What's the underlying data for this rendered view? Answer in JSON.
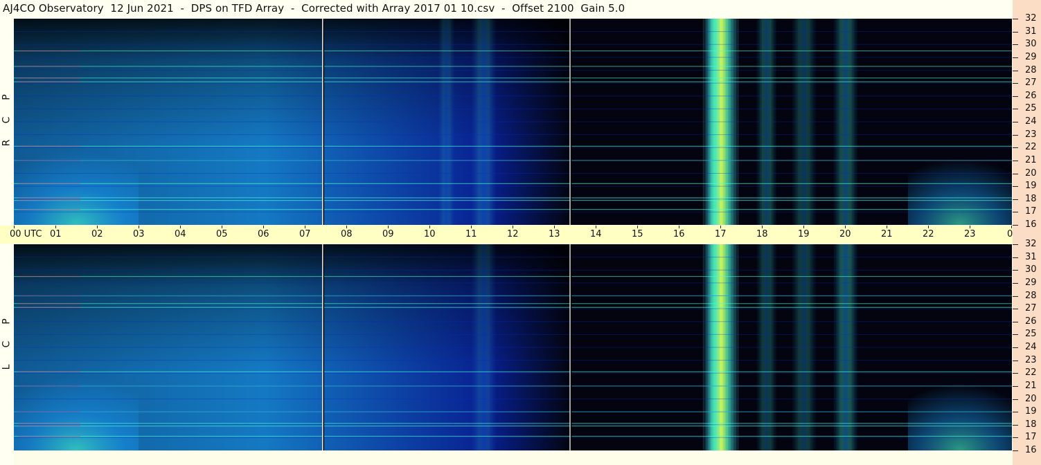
{
  "header": {
    "title": "AJ4CO Observatory  12 Jun 2021  -  DPS on TFD Array  -  Corrected with Array 2017 01 10.csv  -  Offset 2100  Gain 5.0"
  },
  "time_axis": {
    "labels": [
      "00 UTC",
      "01",
      "02",
      "03",
      "04",
      "05",
      "06",
      "07",
      "08",
      "09",
      "10",
      "11",
      "12",
      "13",
      "14",
      "15",
      "16",
      "17",
      "18",
      "19",
      "20",
      "21",
      "22",
      "23",
      "00 MHz"
    ]
  },
  "freq_axis": {
    "labels": [
      "32",
      "31",
      "30",
      "29",
      "28",
      "27",
      "26",
      "25",
      "24",
      "23",
      "22",
      "21",
      "20",
      "19",
      "18",
      "17",
      "16"
    ]
  },
  "panels": {
    "top": {
      "polarization": [
        "P",
        "C",
        "R"
      ]
    },
    "bottom": {
      "polarization": [
        "P",
        "C",
        "L"
      ]
    }
  },
  "colors": {
    "background": "#03040f",
    "low": "#0a2cc8",
    "mid": "#1aa0ff",
    "high": "#48ffd0",
    "peak": "#f0ff40",
    "hot": "#ff3070",
    "header_band": "#ffffc4",
    "scale_band": "#fbdcc4"
  },
  "chart_data": [
    {
      "type": "heatmap",
      "title": "AJ4CO Observatory  12 Jun 2021  -  DPS on TFD Array  -  Corrected with Array 2017 01 10.csv  -  Offset 2100  Gain 5.0",
      "panel": "RCP",
      "xlabel": "UTC",
      "ylabel": "MHz",
      "xlim": [
        0,
        24
      ],
      "ylim": [
        16,
        32
      ],
      "x_ticks": [
        "00",
        "01",
        "02",
        "03",
        "04",
        "05",
        "06",
        "07",
        "08",
        "09",
        "10",
        "11",
        "12",
        "13",
        "14",
        "15",
        "16",
        "17",
        "18",
        "19",
        "20",
        "21",
        "22",
        "23",
        "00"
      ],
      "y_ticks": [
        16,
        17,
        18,
        19,
        20,
        21,
        22,
        23,
        24,
        25,
        26,
        27,
        28,
        29,
        30,
        31,
        32
      ],
      "daytime_glow_utc": [
        0,
        13.4
      ],
      "vertical_gaps_utc": [
        7.45,
        13.4
      ],
      "broadband_bursts_utc": [
        {
          "center": 17.0,
          "width": 0.45,
          "intensity": 1.0
        },
        {
          "center": 16.85,
          "width": 0.2,
          "intensity": 0.6
        },
        {
          "center": 18.1,
          "width": 0.25,
          "intensity": 0.35
        },
        {
          "center": 19.0,
          "width": 0.3,
          "intensity": 0.3
        },
        {
          "center": 20.0,
          "width": 0.3,
          "intensity": 0.4
        },
        {
          "center": 11.3,
          "width": 0.3,
          "intensity": 0.25
        },
        {
          "center": 10.4,
          "width": 0.2,
          "intensity": 0.18
        }
      ],
      "interference_lines_mhz": [
        17.2,
        17.9,
        18.1,
        19.2,
        21.0,
        22.1,
        27.1,
        27.4,
        28.3,
        29.5
      ]
    },
    {
      "type": "heatmap",
      "panel": "LCP",
      "xlabel": "UTC",
      "ylabel": "MHz",
      "xlim": [
        0,
        24
      ],
      "ylim": [
        16,
        32
      ],
      "x_ticks": [
        "00",
        "01",
        "02",
        "03",
        "04",
        "05",
        "06",
        "07",
        "08",
        "09",
        "10",
        "11",
        "12",
        "13",
        "14",
        "15",
        "16",
        "17",
        "18",
        "19",
        "20",
        "21",
        "22",
        "23",
        "00"
      ],
      "y_ticks": [
        16,
        17,
        18,
        19,
        20,
        21,
        22,
        23,
        24,
        25,
        26,
        27,
        28,
        29,
        30,
        31,
        32
      ],
      "daytime_glow_utc": [
        0,
        13.4
      ],
      "vertical_gaps_utc": [
        7.45,
        13.4
      ],
      "broadband_bursts_utc": [
        {
          "center": 17.0,
          "width": 0.45,
          "intensity": 1.0
        },
        {
          "center": 16.85,
          "width": 0.2,
          "intensity": 0.55
        },
        {
          "center": 18.1,
          "width": 0.25,
          "intensity": 0.3
        },
        {
          "center": 19.0,
          "width": 0.3,
          "intensity": 0.3
        },
        {
          "center": 20.0,
          "width": 0.3,
          "intensity": 0.45
        },
        {
          "center": 11.3,
          "width": 0.3,
          "intensity": 0.2
        }
      ],
      "interference_lines_mhz": [
        17.1,
        17.9,
        18.1,
        19.0,
        21.0,
        22.1,
        27.1,
        27.4,
        28.0,
        29.5
      ]
    }
  ]
}
